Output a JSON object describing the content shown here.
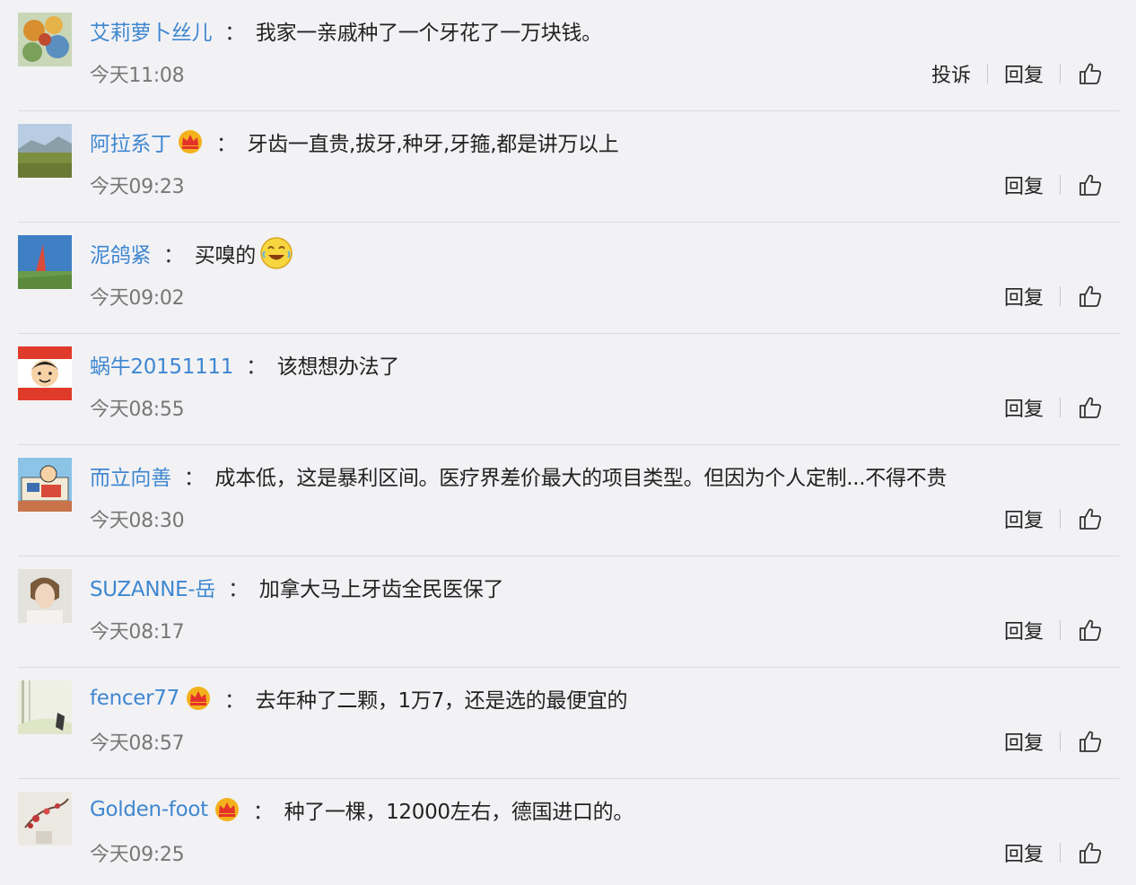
{
  "comments": [
    {
      "username": "艾莉萝卜丝儿",
      "crown": false,
      "text": "我家一亲戚种了一个牙花了一万块钱。",
      "emoji": false,
      "time": "今天11:08",
      "report": "投诉",
      "reply": "回复"
    },
    {
      "username": "阿拉系丁",
      "crown": true,
      "text": "牙齿一直贵,拔牙,种牙,牙箍,都是讲万以上",
      "emoji": false,
      "time": "今天09:23",
      "reply": "回复"
    },
    {
      "username": "泥鸽紧",
      "crown": false,
      "text": "买嗅的",
      "emoji": true,
      "time": "今天09:02",
      "reply": "回复"
    },
    {
      "username": "蜗牛20151111",
      "crown": false,
      "text": "该想想办法了",
      "emoji": false,
      "time": "今天08:55",
      "reply": "回复"
    },
    {
      "username": "而立向善",
      "crown": false,
      "text": "成本低，这是暴利区间。医疗界差价最大的项目类型。但因为个人定制...不得不贵",
      "emoji": false,
      "time": "今天08:30",
      "reply": "回复"
    },
    {
      "username": "SUZANNE-岳",
      "crown": false,
      "text": "加拿大马上牙齿全民医保了",
      "emoji": false,
      "time": "今天08:17",
      "reply": "回复"
    },
    {
      "username": "fencer77",
      "crown": true,
      "text": "去年种了二颗，1万7，还是选的最便宜的",
      "emoji": false,
      "time": "今天08:57",
      "reply": "回复"
    },
    {
      "username": "Golden-foot",
      "crown": true,
      "text": "种了一棵，12000左右，德国进口的。",
      "emoji": false,
      "time": "今天09:25",
      "reply": "回复"
    }
  ],
  "colon": "：",
  "colors": {
    "username": "#3f87d0",
    "background": "#f2f2f5",
    "divider": "#dcdcdf",
    "crown": "#f3b21b"
  },
  "icons": {
    "like": "thumbs-up-icon",
    "crown": "vip-crown-icon",
    "emoji": "laughing-emoji-icon"
  }
}
